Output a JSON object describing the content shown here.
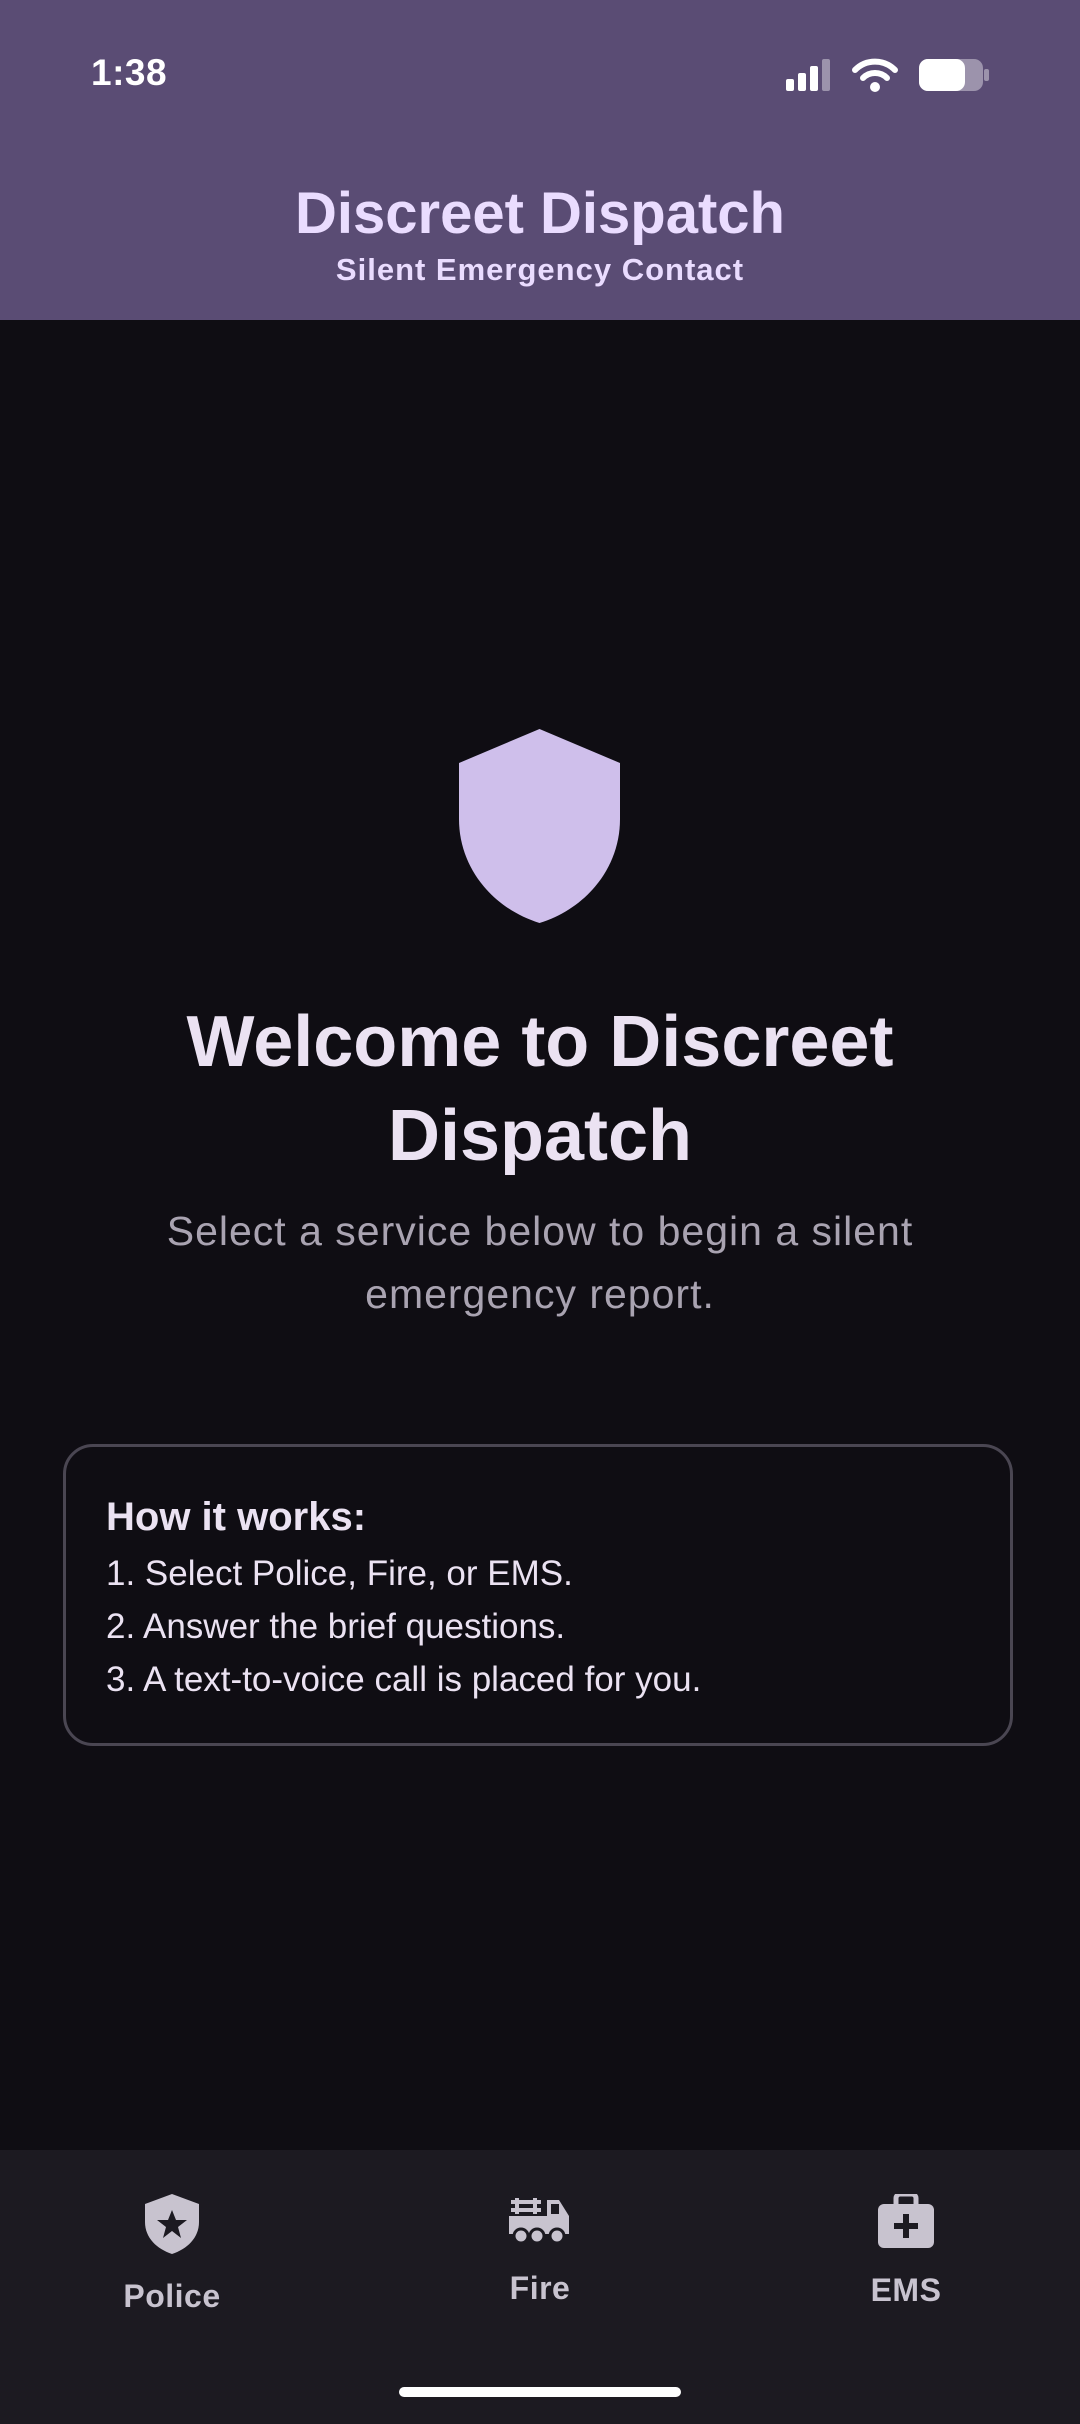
{
  "status_bar": {
    "time": "1:38",
    "icons": [
      "cellular-signal-icon",
      "wifi-icon",
      "battery-icon"
    ]
  },
  "header": {
    "title": "Discreet Dispatch",
    "subtitle": "Silent Emergency Contact"
  },
  "main": {
    "hero_icon": "shield-icon",
    "title": "Welcome to Discreet Dispatch",
    "subtitle": "Select a service below to begin a silent emergency report."
  },
  "how_it_works": {
    "title": "How it works:",
    "steps": [
      "1. Select Police, Fire, or EMS.",
      "2. Answer the brief questions.",
      "3. A text-to-voice call is placed for you."
    ]
  },
  "bottom_nav": {
    "items": [
      {
        "label": "Police",
        "icon": "police-badge-icon"
      },
      {
        "label": "Fire",
        "icon": "fire-truck-icon"
      },
      {
        "label": "EMS",
        "icon": "medical-kit-icon"
      }
    ]
  },
  "colors": {
    "header_bg": "#5a4c74",
    "accent": "#cfbfeb",
    "background": "#0f0d13",
    "nav_bg": "#1c1a21"
  }
}
